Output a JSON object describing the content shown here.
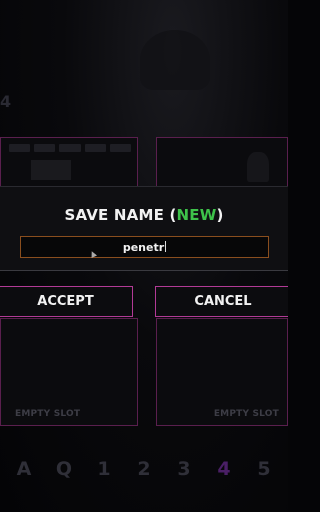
{
  "dialog": {
    "title_prefix": "SAVE NAME (",
    "title_accent": "NEW",
    "title_suffix": ")",
    "name_value": "penetr",
    "accept_label": "ACCEPT",
    "cancel_label": "CANCEL",
    "accent_color": "#3ec24a",
    "button_border_color": "#b23a96"
  },
  "background": {
    "left_digit": "4",
    "slots": [
      {
        "label": "EMPTY SLOT"
      },
      {
        "label": "EMPTY SLOT"
      }
    ],
    "keys": [
      "A",
      "Q",
      "1",
      "2",
      "3",
      "4",
      "5"
    ],
    "active_key": "4"
  }
}
